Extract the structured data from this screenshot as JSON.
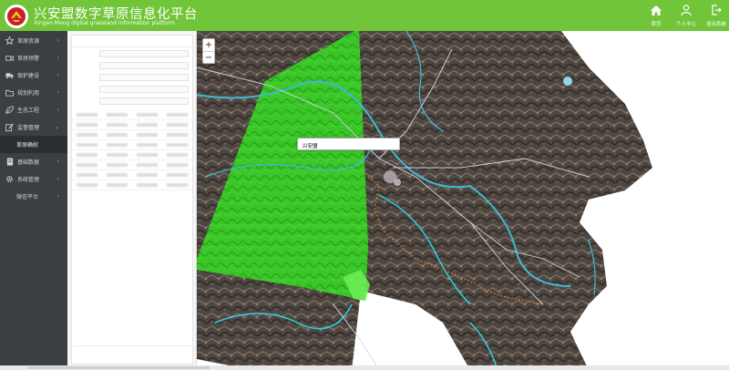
{
  "header": {
    "title": "兴安盟数字草原信息化平台",
    "subtitle": "Xingan Meng digital grassland information platform",
    "nav": [
      {
        "label": "首页",
        "icon": "home-icon"
      },
      {
        "label": "个人中心",
        "icon": "user-icon"
      },
      {
        "label": "退出系统",
        "icon": "logout-icon"
      }
    ]
  },
  "sidebar": {
    "items": [
      {
        "label": "草原资源",
        "icon": "star-icon"
      },
      {
        "label": "草原预警",
        "icon": "camera-icon"
      },
      {
        "label": "保护建设",
        "icon": "truck-icon"
      },
      {
        "label": "规划利用",
        "icon": "folder-icon"
      },
      {
        "label": "生态工程",
        "icon": "leaf-icon"
      },
      {
        "label": "监督管理",
        "icon": "edit-icon"
      },
      {
        "label": "草原确权",
        "icon": ""
      },
      {
        "label": "基础数据",
        "icon": "book-icon"
      },
      {
        "label": "系统管理",
        "icon": "gear-icon"
      },
      {
        "label": "微信平台",
        "icon": ""
      }
    ]
  },
  "map": {
    "zoom_in": "+",
    "zoom_out": "−",
    "popup_text": "兴安盟"
  },
  "colors": {
    "header_bg": "#71c538",
    "sidebar_bg": "#3a3f44",
    "polygon_fill": "#33dd22"
  }
}
